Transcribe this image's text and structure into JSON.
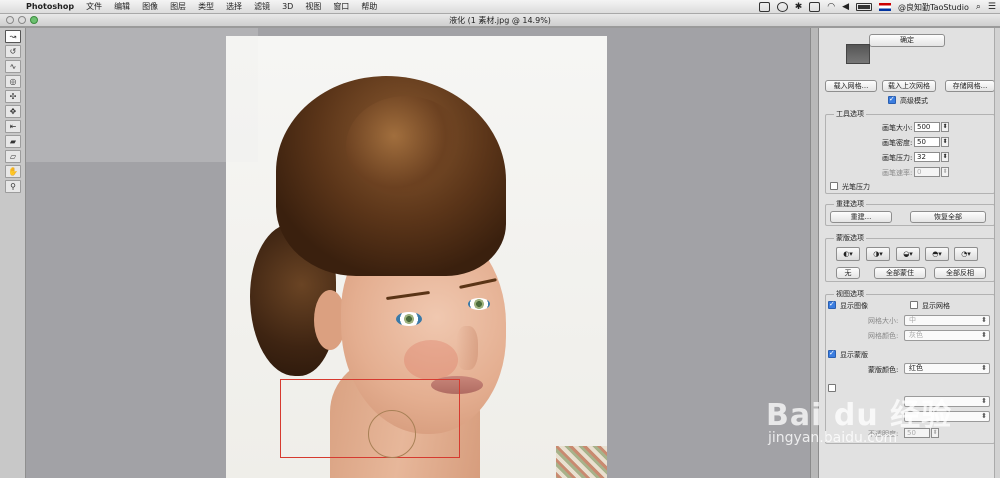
{
  "menubar": {
    "app_name": "Photoshop",
    "items": [
      "文件",
      "编辑",
      "图像",
      "图层",
      "类型",
      "选择",
      "滤镜",
      "3D",
      "视图",
      "窗口",
      "帮助"
    ],
    "user": "@良知勤TaoStudio"
  },
  "window": {
    "title": "液化 (1 素材.jpg @ 14.9%)"
  },
  "panel": {
    "ok_label": "确定",
    "load_mesh": "载入网格...",
    "load_last_mesh": "载入上次网格",
    "save_mesh": "存储网格...",
    "advanced_mode": "高级模式",
    "tool_options": {
      "title": "工具选项",
      "brush_size_label": "画笔大小:",
      "brush_size": "500",
      "brush_density_label": "画笔密度:",
      "brush_density": "50",
      "brush_pressure_label": "画笔压力:",
      "brush_pressure": "32",
      "brush_rate_label": "画笔速率:",
      "brush_rate": "0",
      "stylus_pressure": "光笔压力"
    },
    "reconstruct": {
      "title": "重建选项",
      "reconstruct_btn": "重建...",
      "restore_all_btn": "恢复全部"
    },
    "mask": {
      "title": "蒙版选项",
      "none_btn": "无",
      "mask_all_btn": "全部蒙住",
      "invert_all_btn": "全部反相"
    },
    "view": {
      "title": "视图选项",
      "show_image": "显示图像",
      "show_mesh": "显示网格",
      "mesh_size_label": "网格大小:",
      "mesh_size": "中",
      "mesh_color_label": "网格颜色:",
      "mesh_color": "灰色",
      "show_mask": "显示蒙版",
      "mask_color_label": "蒙版颜色:",
      "mask_color": "红色",
      "backdrop_opacity_label": "不透明度:",
      "backdrop_opacity": "50"
    }
  },
  "watermark": {
    "logo": "Bai du 经验",
    "url": "jingyan.baidu.com"
  }
}
